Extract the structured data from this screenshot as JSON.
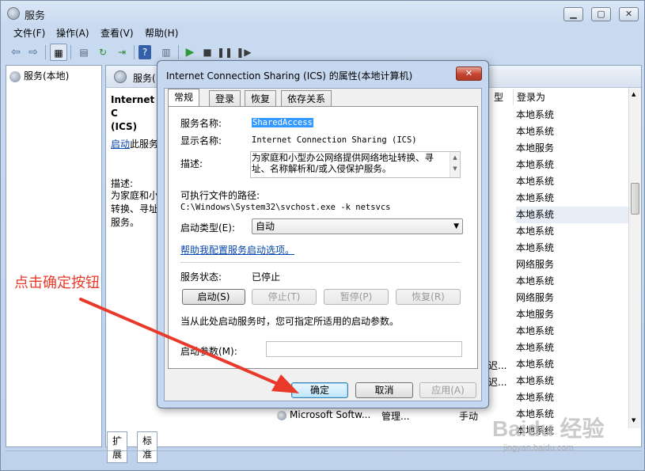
{
  "window": {
    "title": "服务"
  },
  "menu": [
    "文件(F)",
    "操作(A)",
    "查看(V)",
    "帮助(H)"
  ],
  "left_pane": {
    "tree_item": "服务(本地)"
  },
  "right_pane": {
    "header": "服务(",
    "desc_title": "Internet Connection Sharing (ICS)",
    "desc_title_line1": "Internet C",
    "desc_title_line2": "(ICS)",
    "start_link": "启动",
    "start_link_suffix": "此服务",
    "desc_label": "描述:",
    "desc_body": "为家庭和小转换、寻址服务。",
    "desc_body_lines": [
      "为家庭和小",
      "转换、寻址",
      "服务。"
    ],
    "col_partial": "型",
    "col_logon": "登录为",
    "logon_values": [
      "本地系统",
      "本地系统",
      "本地服务",
      "本地系统",
      "本地系统",
      "本地系统",
      "本地系统",
      "本地系统",
      "本地系统",
      "网络服务",
      "本地系统",
      "网络服务",
      "本地服务",
      "本地系统",
      "本地系统",
      "本地系统",
      "本地系统",
      "本地系统",
      "本地系统",
      "本地系统"
    ],
    "bottom_row": {
      "name": "Microsoft Softw...",
      "status": "管理...",
      "start": "手动",
      "logon": "本地系统"
    },
    "partial_rows": [
      "迟...",
      "迟..."
    ]
  },
  "bottom_tabs": [
    "扩展",
    "标准"
  ],
  "dialog": {
    "title": "Internet Connection Sharing (ICS) 的属性(本地计算机)",
    "close": "✕",
    "tabs": [
      "常规",
      "登录",
      "恢复",
      "依存关系"
    ],
    "service_name_label": "服务名称:",
    "service_name": "SharedAccess",
    "display_name_label": "显示名称:",
    "display_name": "Internet Connection Sharing (ICS)",
    "description_label": "描述:",
    "description": "为家庭和小型办公网络提供网络地址转换、寻址、名称解析和/或入侵保护服务。",
    "exe_label": "可执行文件的路径:",
    "exe_path": "C:\\Windows\\System32\\svchost.exe -k netsvcs",
    "startup_type_label": "启动类型(E):",
    "startup_type": "自动",
    "help_link": "帮助我配置服务启动选项。",
    "status_label": "服务状态:",
    "status_value": "已停止",
    "btn_start": "启动(S)",
    "btn_stop": "停止(T)",
    "btn_pause": "暂停(P)",
    "btn_resume": "恢复(R)",
    "hint": "当从此处启动服务时，您可指定所适用的启动参数。",
    "param_label": "启动参数(M):",
    "ok": "确定",
    "cancel": "取消",
    "apply": "应用(A)"
  },
  "annotation": "点击确定按钮",
  "watermark": {
    "brand": "Baidu 经验",
    "url": "jingyan.baidu.com"
  }
}
